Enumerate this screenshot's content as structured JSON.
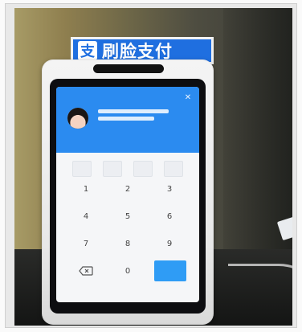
{
  "sign": {
    "logo_glyph": "支",
    "text": "刷脸支付"
  },
  "device": {
    "keys": [
      "1",
      "2",
      "3",
      "4",
      "5",
      "6",
      "7",
      "8",
      "9",
      "0"
    ],
    "colors": {
      "header_blue": "#2b8bf0",
      "confirm_blue": "#2f9cf5",
      "sign_blue": "#1f6fe0"
    },
    "icons": {
      "backspace": "backspace-icon",
      "close": "close-icon",
      "avatar": "avatar"
    }
  }
}
